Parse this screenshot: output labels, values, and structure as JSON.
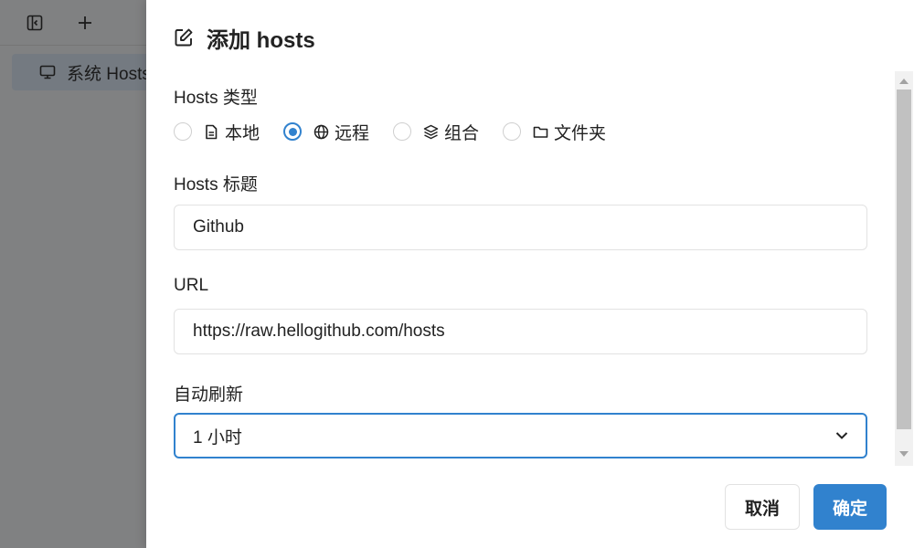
{
  "app": {
    "list_item_label": "系统 Hosts"
  },
  "dialog": {
    "title": "添加 hosts",
    "hosts_type": {
      "label": "Hosts 类型",
      "options": [
        {
          "label": "本地",
          "icon": "file-icon",
          "checked": false
        },
        {
          "label": "远程",
          "icon": "globe-icon",
          "checked": true
        },
        {
          "label": "组合",
          "icon": "layers-icon",
          "checked": false
        },
        {
          "label": "文件夹",
          "icon": "folder-icon",
          "checked": false
        }
      ]
    },
    "hosts_title": {
      "label": "Hosts 标题",
      "value": "Github"
    },
    "url": {
      "label": "URL",
      "value": "https://raw.hellogithub.com/hosts"
    },
    "auto_refresh": {
      "label": "自动刷新",
      "value": "1 小时"
    },
    "buttons": {
      "cancel": "取消",
      "ok": "确定"
    }
  },
  "colors": {
    "accent": "#3182ce",
    "overlay": "#7a7a7a"
  }
}
